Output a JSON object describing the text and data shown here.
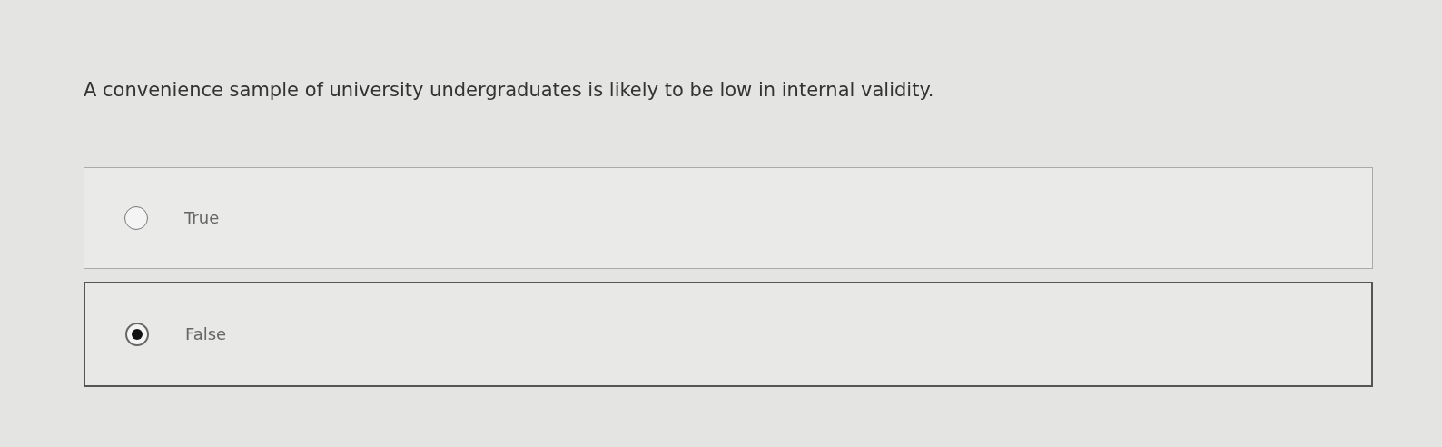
{
  "question": "A convenience sample of university undergraduates is likely to be low in internal validity.",
  "options": [
    {
      "label": "True",
      "selected": false
    },
    {
      "label": "False",
      "selected": true
    }
  ]
}
